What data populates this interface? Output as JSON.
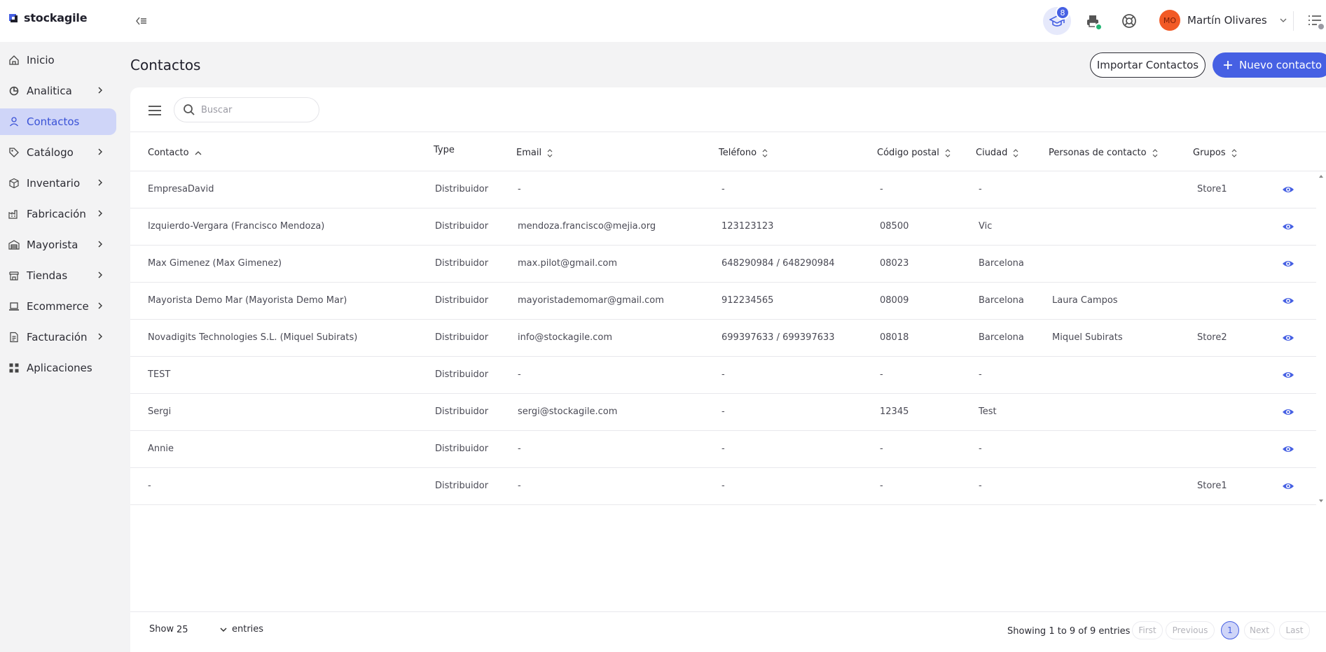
{
  "app": {
    "logo_text": "stockagile"
  },
  "topbar": {
    "academy_badge": "8",
    "user": {
      "initials": "MO",
      "name": "Martín Olivares"
    }
  },
  "sidebar": {
    "items": [
      {
        "label": "Inicio",
        "icon": "home-icon",
        "has_chevron": false
      },
      {
        "label": "Analitica",
        "icon": "analytics-icon",
        "has_chevron": true
      },
      {
        "label": "Contactos",
        "icon": "user-icon",
        "has_chevron": false,
        "active": true
      },
      {
        "label": "Catálogo",
        "icon": "tag-icon",
        "has_chevron": true
      },
      {
        "label": "Inventario",
        "icon": "box-icon",
        "has_chevron": true
      },
      {
        "label": "Fabricación",
        "icon": "factory-icon",
        "has_chevron": true
      },
      {
        "label": "Mayorista",
        "icon": "warehouse-icon",
        "has_chevron": true
      },
      {
        "label": "Tiendas",
        "icon": "store-icon",
        "has_chevron": true
      },
      {
        "label": "Ecommerce",
        "icon": "laptop-icon",
        "has_chevron": true
      },
      {
        "label": "Facturación",
        "icon": "invoice-icon",
        "has_chevron": true
      },
      {
        "label": "Aplicaciones",
        "icon": "apps-icon",
        "has_chevron": false
      }
    ]
  },
  "page": {
    "title": "Contactos",
    "import_label": "Importar Contactos",
    "new_label": "Nuevo contacto"
  },
  "search": {
    "placeholder": "Buscar"
  },
  "table": {
    "columns": [
      "Contacto",
      "Type",
      "Email",
      "Teléfono",
      "Código postal",
      "Ciudad",
      "Personas de contacto",
      "Grupos"
    ],
    "rows": [
      [
        "EmpresaDavid",
        "Distribuidor",
        "-",
        "-",
        "-",
        "-",
        "",
        "Store1"
      ],
      [
        "Izquierdo-Vergara (Francisco Mendoza)",
        "Distribuidor",
        "mendoza.francisco@mejia.org",
        "123123123",
        "08500",
        "Vic",
        "",
        ""
      ],
      [
        "Max Gimenez (Max Gimenez)",
        "Distribuidor",
        "max.pilot@gmail.com",
        "648290984 / 648290984",
        "08023",
        "Barcelona",
        "",
        ""
      ],
      [
        "Mayorista Demo Mar (Mayorista Demo Mar)",
        "Distribuidor",
        "mayoristademomar@gmail.com",
        "912234565",
        "08009",
        "Barcelona",
        "Laura Campos",
        ""
      ],
      [
        "Novadigits Technologies S.L. (Miquel Subirats)",
        "Distribuidor",
        "info@stockagile.com",
        "699397633 / 699397633",
        "08018",
        "Barcelona",
        "Miquel Subirats",
        "Store2"
      ],
      [
        "TEST",
        "Distribuidor",
        "-",
        "-",
        "-",
        "-",
        "",
        ""
      ],
      [
        "Sergi",
        "Distribuidor",
        "sergi@stockagile.com",
        "-",
        "12345",
        "Test",
        "",
        ""
      ],
      [
        "Annie",
        "Distribuidor",
        "-",
        "-",
        "-",
        "-",
        "",
        ""
      ],
      [
        "-",
        "Distribuidor",
        "-",
        "-",
        "-",
        "-",
        "",
        "Store1"
      ]
    ]
  },
  "footer": {
    "show_label": "Show",
    "page_size": "25",
    "entries_label": "entries",
    "showing_text": "Showing 1 to 9 of 9 entries",
    "pagination": {
      "first": "First",
      "previous": "Previous",
      "current": "1",
      "next": "Next",
      "last": "Last"
    }
  },
  "colors": {
    "accent": "#4660e3",
    "active_bg": "#cfd5f8",
    "avatar": "#f25a26"
  }
}
